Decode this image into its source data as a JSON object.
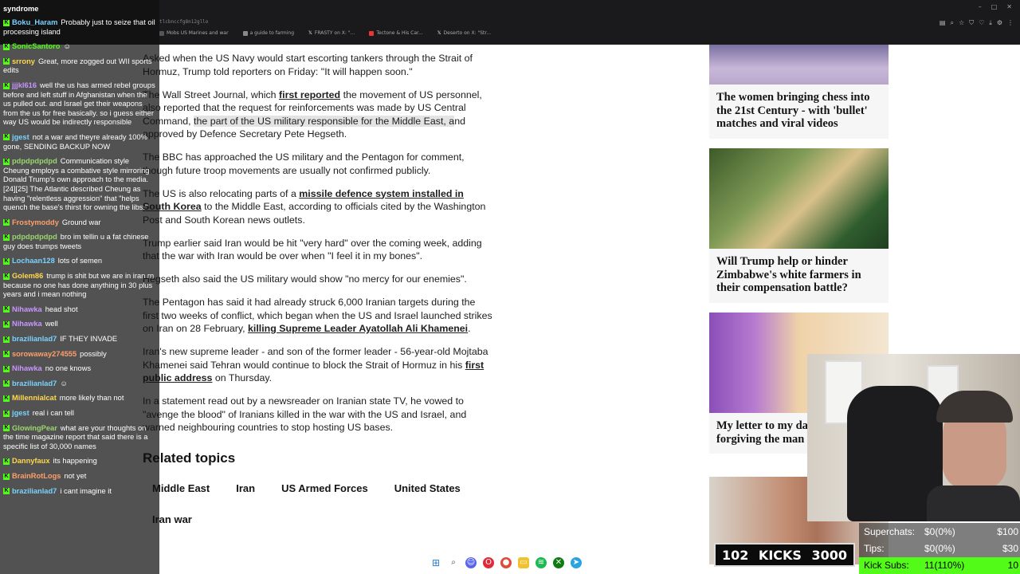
{
  "browser": {
    "address": "tlcbnccfg8n12gllo",
    "tabs": [
      {
        "label": "Mobs US Marines and war",
        "color": "#555"
      },
      {
        "label": "a guide to farming",
        "color": "#888"
      },
      {
        "label": "FRASTY on X: \"...",
        "color": "#fff"
      },
      {
        "label": "Tectone & His Car...",
        "color": "#e33"
      },
      {
        "label": "Deserto on X: \"Str...",
        "color": "#fff"
      }
    ]
  },
  "article": {
    "p1": "Asked when the US Navy would start escorting tankers through the Strait of Hormuz, Trump told reporters on Friday: \"It will happen soon.\"",
    "p2_a": "The Wall Street Journal, which ",
    "p2_link": "first reported",
    "p2_b": " the movement of US personnel, also reported that the request for reinforcements was made by US Central Command, ",
    "p2_hl": "the part of the US military responsible for the Middle East, a",
    "p2_c": "nd approved by Defence Secretary Pete Hegseth.",
    "p3": "The BBC has approached the US military and the Pentagon for comment, though future troop movements are usually not confirmed publicly.",
    "p4_a": "The US is also relocating parts of a ",
    "p4_link": "missile defence system installed in South Korea",
    "p4_b": " to the Middle East, according to officials cited by the Washington Post and South Korean news outlets.",
    "p5": "Trump earlier said Iran would be hit \"very hard\" over the coming week, adding that the war with Iran would be over when \"I feel it in my bones\".",
    "p6": "Hegseth also said the US military would show \"no mercy for our enemies\".",
    "p7_a": "The Pentagon has said it had already struck 6,000 Iranian targets during the first two weeks of conflict, which began when the US and Israel launched strikes on Iran on 28 February, ",
    "p7_link": "killing Supreme Leader Ayatollah Ali Khamenei",
    "p7_b": ".",
    "p8_a": "Iran's new supreme leader - and son of the former leader - 56-year-old Mojtaba Khamenei said Tehran would continue to block the Strait of Hormuz in his ",
    "p8_link": "first public address",
    "p8_b": " on Thursday.",
    "p9": "In a statement read out by a newsreader on Iranian state TV, he vowed to \"avenge the blood\" of Iranians killed in the war with the US and Israel, and warned neighbouring countries to stop hosting US bases.",
    "related_title": "Related topics",
    "topics": [
      "Middle East",
      "Iran",
      "US Armed Forces",
      "United States",
      "Iran war"
    ]
  },
  "cards": [
    {
      "title": "The women bringing chess into the 21st Century - with 'bullet' matches and viral videos"
    },
    {
      "title": "Will Trump help or hinder Zimbabwe's white farmers in their compensation battle?"
    },
    {
      "title": "My letter to my dad - after forgiving the man who killed her"
    }
  ],
  "chat": {
    "top": "syndrome",
    "messages": [
      {
        "user": "Boku_Haram",
        "text": "Probably just to seize that oil processing island"
      },
      {
        "user": "SonicSantoro",
        "text": ""
      },
      {
        "user": "srrony",
        "text": "Great, more zogged out WII sports edits"
      },
      {
        "user": "jjjkl616",
        "text": "well the us has armed rebel groups before and left stuff in Afghanistan when the us pulled out. and Israel get their weapons from the us for free basically. so i guess either way US would be indirectly responsible"
      },
      {
        "user": "jgest",
        "text": "not a war and theyre already 100% gone, SENDING BACKUP NOW"
      },
      {
        "user": "pdpdpdpdpd",
        "text": "Communication style Cheung employs a combative style mirroring Donald Trump's own approach to the media.[24][25] The Atlantic described Cheung as having \"relentless aggression\" that \"helps quench the base's thirst for owning the libs.\""
      },
      {
        "user": "Frostymoddy",
        "text": "Ground war"
      },
      {
        "user": "pdpdpdpdpd",
        "text": "bro im tellin u a fat chinese guy does trumps tweets"
      },
      {
        "user": "Lochaan128",
        "text": "lots of semen"
      },
      {
        "user": "Golem86",
        "text": "trump is shit but we are in iran rn because no one has done anything in 30 plus years and i mean nothing"
      },
      {
        "user": "Nihawka",
        "text": "head shot"
      },
      {
        "user": "Nihawka",
        "text": "well"
      },
      {
        "user": "brazilianlad7",
        "text": "IF THEY INVADE"
      },
      {
        "user": "sorowaway274555",
        "text": "possibly"
      },
      {
        "user": "Nihawka",
        "text": "no one knows"
      },
      {
        "user": "brazilianlad7",
        "text": ""
      },
      {
        "user": "Millennialcat",
        "text": "more likely than not"
      },
      {
        "user": "jgest",
        "text": "real i can tell"
      },
      {
        "user": "GlowingPear",
        "text": "what are your thoughts on the time magazine report that said there is a specific list of 30,000 names"
      },
      {
        "user": "Dannyfaux",
        "text": "its happening"
      },
      {
        "user": "BrainRotLogs",
        "text": "not yet"
      },
      {
        "user": "brazilianlad7",
        "text": "i cant imagine it"
      }
    ]
  },
  "kicks": {
    "count": "102",
    "label": "KICKS",
    "goal": "3000"
  },
  "stats": [
    {
      "label": "Superchats:",
      "value": "$0(0%)",
      "goal": "$100"
    },
    {
      "label": "Tips:",
      "value": "$0(0%)",
      "goal": "$30"
    },
    {
      "label": "Kick Subs:",
      "value": "11(110%)",
      "goal": "10"
    }
  ],
  "colors": {
    "kick_green": "#53fc18",
    "card_bg": "#f6f6f6",
    "topbar": "#1a1a1c"
  }
}
